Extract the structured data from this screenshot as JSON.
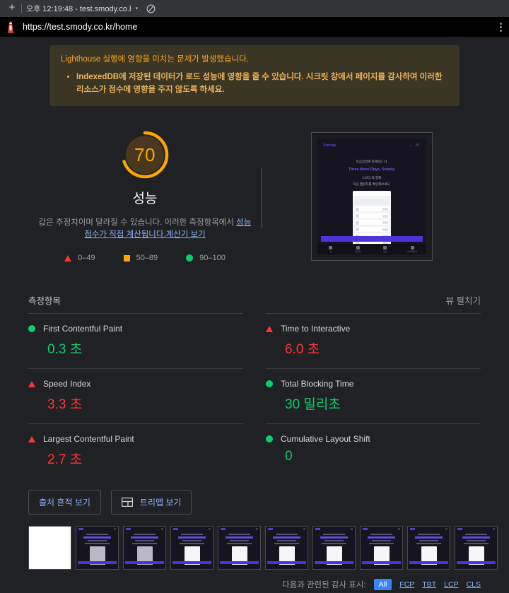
{
  "browser": {
    "new_tab_label": "+",
    "tab_title": "오후 12:19:48 - test.smody.co.ŀ",
    "tab_caret": "▾",
    "block_icon_name": "no-entry-icon",
    "url": "https://test.smody.co.kr/home",
    "menu_icon_name": "kebab-menu-icon"
  },
  "warning": {
    "heading": "Lighthouse 실행에 영향을 미치는 문제가 발생했습니다.",
    "items": [
      "IndexedDB에 저장된 데이터가 로드 성능에 영향을 줄 수 있습니다. 시크릿 창에서 페이지를 감사하여 이러한 리소스가 점수에 영향을 주지 않도록 하세요."
    ],
    "bg_color": "#3b3524",
    "text_color": "#f5a623"
  },
  "gauge": {
    "score": "70",
    "score_number": 70,
    "label": "성능",
    "color": "#ffa400",
    "track_color": "#4a3b22",
    "description_line1": "값은 추정치이며 달라질 수 있습니다. 이러한 측정항목에서",
    "description_link": "성능 점수가 직접 계산됩니다.",
    "calculator_link": "계산기 보기"
  },
  "legend": [
    {
      "marker": "triangle-red-icon",
      "range": "0–49",
      "color": "#ff3333"
    },
    {
      "marker": "square-orange-icon",
      "range": "50–89",
      "color": "#ffa400"
    },
    {
      "marker": "circle-green-icon",
      "range": "90–100",
      "color": "#0cce6b"
    }
  ],
  "screenshot_preview": {
    "logo": "Smody",
    "icons": "⌄ ⏻",
    "headline1": "작심삼일에 지쳐있는 너",
    "headline2": "Three More Days, Smody",
    "headline3": "스모디 와 함께",
    "headline4": "작심 챌린지를 확인해보세요",
    "cta": "시작하기",
    "nav_items": [
      "홈",
      "챌린지",
      "피드",
      "마이페이지"
    ]
  },
  "metrics_section": {
    "title": "측정항목",
    "expand_label": "뷰 펼치기",
    "metrics": [
      {
        "name": "First Contentful Paint",
        "value": "0.3 초",
        "status": "good",
        "marker": "circle-green-icon"
      },
      {
        "name": "Time to Interactive",
        "value": "6.0 초",
        "status": "bad",
        "marker": "triangle-red-icon"
      },
      {
        "name": "Speed Index",
        "value": "3.3 초",
        "status": "bad",
        "marker": "triangle-red-icon"
      },
      {
        "name": "Total Blocking Time",
        "value": "30 밀리초",
        "status": "good",
        "marker": "circle-green-icon"
      },
      {
        "name": "Largest Contentful Paint",
        "value": "2.7 초",
        "status": "bad",
        "marker": "triangle-red-icon"
      },
      {
        "name": "Cumulative Layout Shift",
        "value": "0",
        "status": "good",
        "marker": "circle-green-icon"
      }
    ]
  },
  "buttons": {
    "trace_label": "출처 흔적 보기",
    "treemap_label": "트리맵 보기",
    "treemap_icon": "treemap-icon"
  },
  "filmstrip": {
    "frames": [
      {
        "kind": "blank"
      },
      {
        "kind": "loading-gray"
      },
      {
        "kind": "loading-gray"
      },
      {
        "kind": "loaded"
      },
      {
        "kind": "loaded"
      },
      {
        "kind": "loaded"
      },
      {
        "kind": "loaded"
      },
      {
        "kind": "loaded"
      },
      {
        "kind": "loaded"
      },
      {
        "kind": "loaded"
      }
    ]
  },
  "footer": {
    "label": "다음과 관련된 감사 표시:",
    "filters": [
      {
        "label": "All",
        "active": true
      },
      {
        "label": "FCP",
        "active": false
      },
      {
        "label": "TBT",
        "active": false
      },
      {
        "label": "LCP",
        "active": false
      },
      {
        "label": "CLS",
        "active": false
      }
    ]
  }
}
